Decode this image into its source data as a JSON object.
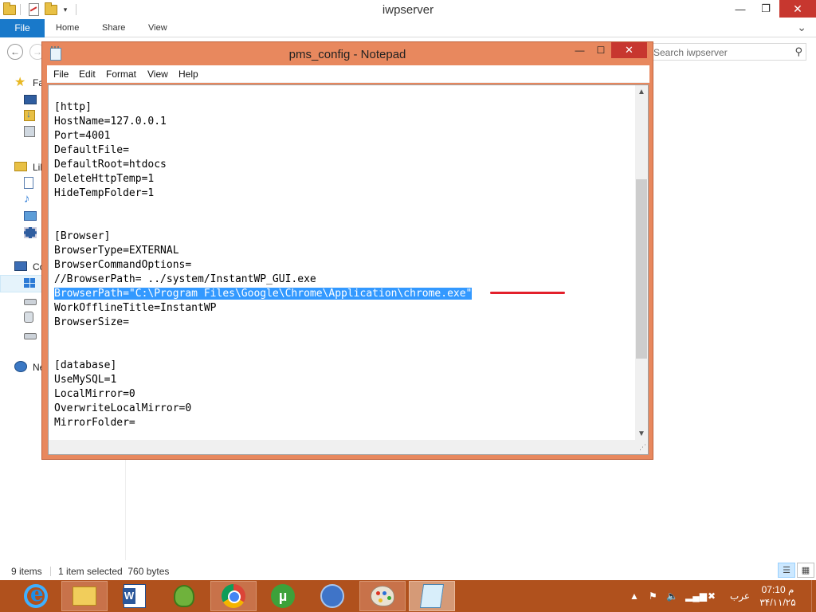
{
  "explorer": {
    "title": "iwpserver",
    "ribbon_tabs": {
      "file": "File",
      "home": "Home",
      "share": "Share",
      "view": "View"
    },
    "search_placeholder": "Search iwpserver",
    "nav_labels": {
      "favorites": "Fa",
      "libraries": "Lil",
      "computer": "Co",
      "network": "Ne"
    },
    "status": {
      "items": "9 items",
      "selection": "1 item selected  760 bytes"
    }
  },
  "notepad": {
    "title": "pms_config - Notepad",
    "menu": {
      "file": "File",
      "edit": "Edit",
      "format": "Format",
      "view": "View",
      "help": "Help"
    },
    "lines": [
      "[http]",
      "HostName=127.0.0.1",
      "Port=4001",
      "DefaultFile=",
      "DefaultRoot=htdocs",
      "DeleteHttpTemp=1",
      "HideTempFolder=1",
      "",
      "",
      "[Browser]",
      "BrowserType=EXTERNAL",
      "BrowserCommandOptions=",
      "//BrowserPath= ../system/InstantWP_GUI.exe",
      "BrowserPath=\"C:\\Program Files\\Google\\Chrome\\Application\\chrome.exe\"",
      "WorkOfflineTitle=InstantWP",
      "BrowserSize=",
      "",
      "",
      "[database]",
      "UseMySQL=1",
      "LocalMirror=0",
      "OverwriteLocalMirror=0",
      "MirrorFolder="
    ],
    "selected_line_index": 13
  },
  "taskbar": {
    "apps": [
      "internet-explorer-icon",
      "file-explorer-icon",
      "word-icon",
      "turtle-app-icon",
      "chrome-icon",
      "utorrent-icon",
      "wamp-icon",
      "paint-icon",
      "notepad-icon"
    ],
    "utorrent_glyph": "µ",
    "language": "عرب",
    "time": "07:10 م",
    "date": "۳۴/۱۱/۲۵"
  },
  "colors": {
    "notepad_frame": "#e8885e",
    "taskbar": "#b0511d",
    "selection": "#3399ff",
    "annotation": "#e3202b",
    "ribbon_file": "#1979ca"
  }
}
